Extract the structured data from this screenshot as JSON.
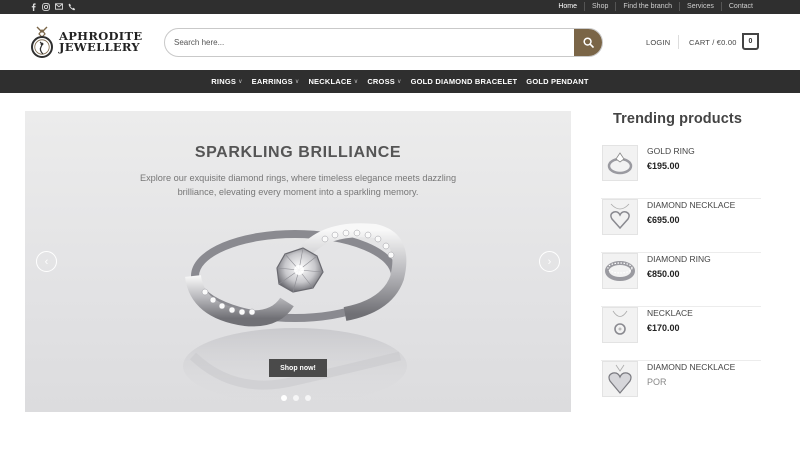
{
  "topbar": {
    "socials": [
      "facebook-icon",
      "instagram-icon",
      "mail-icon",
      "phone-icon"
    ],
    "links": [
      "Home",
      "Shop",
      "Find the branch",
      "Services",
      "Contact"
    ]
  },
  "header": {
    "logo_line1": "APHRODITE",
    "logo_line2": "JEWELLERY",
    "search_placeholder": "Search here...",
    "login": "LOGIN",
    "cart": "CART / €0.00",
    "cart_count": "0"
  },
  "mainnav": [
    {
      "label": "RINGS",
      "dropdown": true
    },
    {
      "label": "EARRINGS",
      "dropdown": true
    },
    {
      "label": "NECKLACE",
      "dropdown": true
    },
    {
      "label": "CROSS",
      "dropdown": true
    },
    {
      "label": "GOLD DIAMOND BRACELET",
      "dropdown": false
    },
    {
      "label": "GOLD PENDANT",
      "dropdown": false
    }
  ],
  "slider": {
    "title": "SPARKLING BRILLIANCE",
    "description": "Explore our exquisite diamond rings, where timeless elegance meets dazzling brilliance, elevating every moment into a sparkling memory.",
    "cta": "Shop now!",
    "slides": 3,
    "active_slide": 1
  },
  "trending": {
    "title": "Trending products",
    "products": [
      {
        "name": "GOLD RING",
        "price": "€195.00",
        "icon": "ring-icon"
      },
      {
        "name": "DIAMOND NECKLACE",
        "price": "€695.00",
        "icon": "heart-necklace-icon"
      },
      {
        "name": "DIAMOND RING",
        "price": "€850.00",
        "icon": "band-ring-icon"
      },
      {
        "name": "NECKLACE",
        "price": "€170.00",
        "icon": "pendant-icon"
      },
      {
        "name": "DIAMOND NECKLACE",
        "price": "POR",
        "icon": "heart-pendant-icon"
      }
    ]
  },
  "colors": {
    "dark_bar": "#2f2f2f",
    "accent": "#7a6547",
    "button": "#4a4a4a"
  }
}
